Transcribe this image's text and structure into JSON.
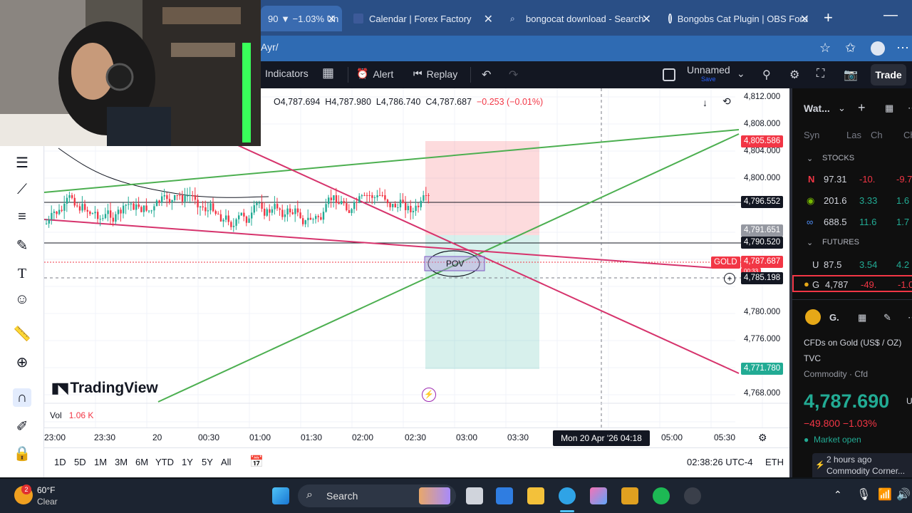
{
  "browser": {
    "tabs": [
      {
        "label": "90 ▼ −1.03% Un",
        "active": true
      },
      {
        "label": "Calendar | Forex Factory"
      },
      {
        "label": "bongocat download - Search"
      },
      {
        "label": "Bongobs Cat Plugin | OBS Foru"
      }
    ],
    "address": "Ayr/"
  },
  "toolbar": {
    "indicators": "Indicators",
    "alert": "Alert",
    "replay": "Replay",
    "layout_name": "Unnamed",
    "layout_save": "Save",
    "trade": "Trade"
  },
  "chart": {
    "ohlc": {
      "open": "O4,787.694",
      "high": "H4,787.980",
      "low": "L4,786.740",
      "close": "C4,787.687",
      "change": "−0.253 (−0.01%)"
    },
    "price_axis": [
      "4,812.000",
      "4,808.000",
      "4,804.000",
      "4,800.000",
      "4,780.000",
      "4,776.000",
      "4,768.000"
    ],
    "price_labels": {
      "tp": "4,805.586",
      "level1": "4,796.552",
      "level2": "4,791.651",
      "level3": "4,790.520",
      "symbol": "GOLD",
      "current": "4,787.687",
      "countdown": "00:33",
      "crosshair": "4,785.198",
      "sl": "4,771.780"
    },
    "annotation": "POV",
    "brand": "TradingView",
    "volume_label": "Vol",
    "volume_value": "1.06 K",
    "time_axis": [
      "23:00",
      "23:30",
      "20",
      "00:30",
      "01:00",
      "01:30",
      "02:00",
      "02:30",
      "03:00",
      "03:30",
      "05:00",
      "05:30"
    ],
    "crosshair_time": "Mon 20 Apr '26   04:18",
    "colors": {
      "up": "#22ab94",
      "down": "#f23645",
      "trend_pink": "#d6336c",
      "trend_green": "#4caf50"
    }
  },
  "range_bar": {
    "ranges": [
      "1D",
      "5D",
      "1M",
      "3M",
      "6M",
      "YTD",
      "1Y",
      "5Y",
      "All"
    ],
    "clock": "02:38:26 UTC-4",
    "session": "ETH"
  },
  "watchlist": {
    "title": "Wat...",
    "columns": [
      "Syn",
      "Las",
      "Ch",
      "Ch"
    ],
    "sections": [
      {
        "name": "STOCKS",
        "rows": [
          {
            "sym": "N",
            "last": "97.31",
            "chg": "-10.",
            "chgp": "-9.7"
          },
          {
            "sym": "",
            "last": "201.6",
            "chg": "3.33",
            "chgp": "1.6"
          },
          {
            "sym": "",
            "last": "688.5",
            "chg": "11.6",
            "chgp": "1.7"
          }
        ]
      },
      {
        "name": "FUTURES",
        "rows": [
          {
            "sym": "U",
            "last": "87.5",
            "chg": "3.54",
            "chgp": "4.2"
          },
          {
            "sym": "G",
            "last": "4,787",
            "chg": "-49.",
            "chgp": "-1.0"
          }
        ]
      }
    ],
    "detail": {
      "sym": "G.",
      "desc": "CFDs on Gold (US$ / OZ)",
      "exchange": "TVC",
      "category": "Commodity · Cfd",
      "price": "4,787.690",
      "currency": "US",
      "change": "−49.800 −1.03%",
      "status": "Market open",
      "news_time": "2 hours ago",
      "news_src": "Commodity Corner..."
    }
  },
  "taskbar": {
    "temp": "60°F",
    "weather": "Clear",
    "badge": "2",
    "search": "Search"
  }
}
